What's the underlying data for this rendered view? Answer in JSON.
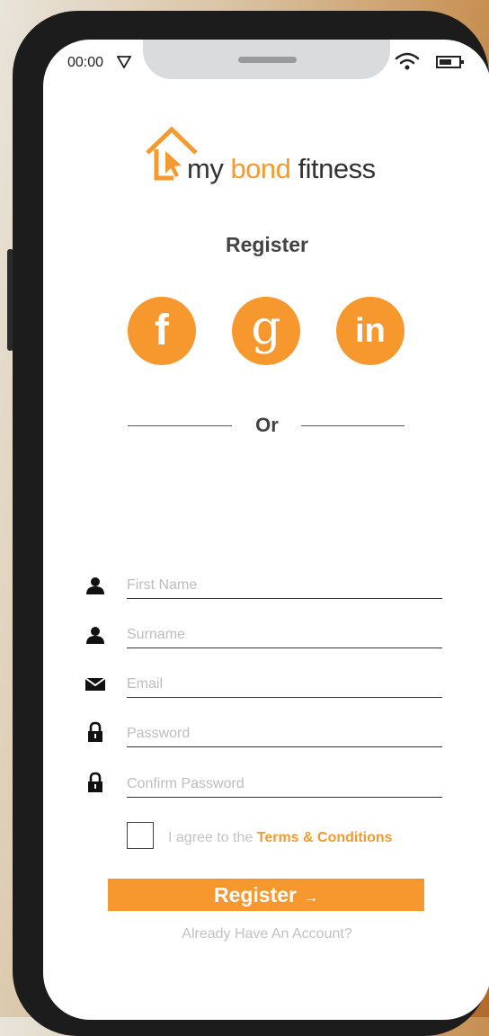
{
  "status_bar": {
    "time": "00:00"
  },
  "logo": {
    "part1": "my ",
    "part2": "bond",
    "part3": " fitness"
  },
  "title": "Register",
  "social": {
    "facebook": "f",
    "google": "g",
    "linkedin": "in"
  },
  "divider_text": "Or",
  "form": {
    "first_name_placeholder": "First Name",
    "surname_placeholder": "Surname",
    "email_placeholder": "Email",
    "password_placeholder": "Password",
    "confirm_password_placeholder": "Confirm Password"
  },
  "agree": {
    "prefix": "I agree to the ",
    "terms_link": "Terms & Conditions"
  },
  "register_button": {
    "label": "Register",
    "arrow": "→"
  },
  "already_link": "Already Have An Account?",
  "colors": {
    "accent": "#f7982f",
    "text_dark": "#444444",
    "placeholder": "#bdbdbd"
  }
}
